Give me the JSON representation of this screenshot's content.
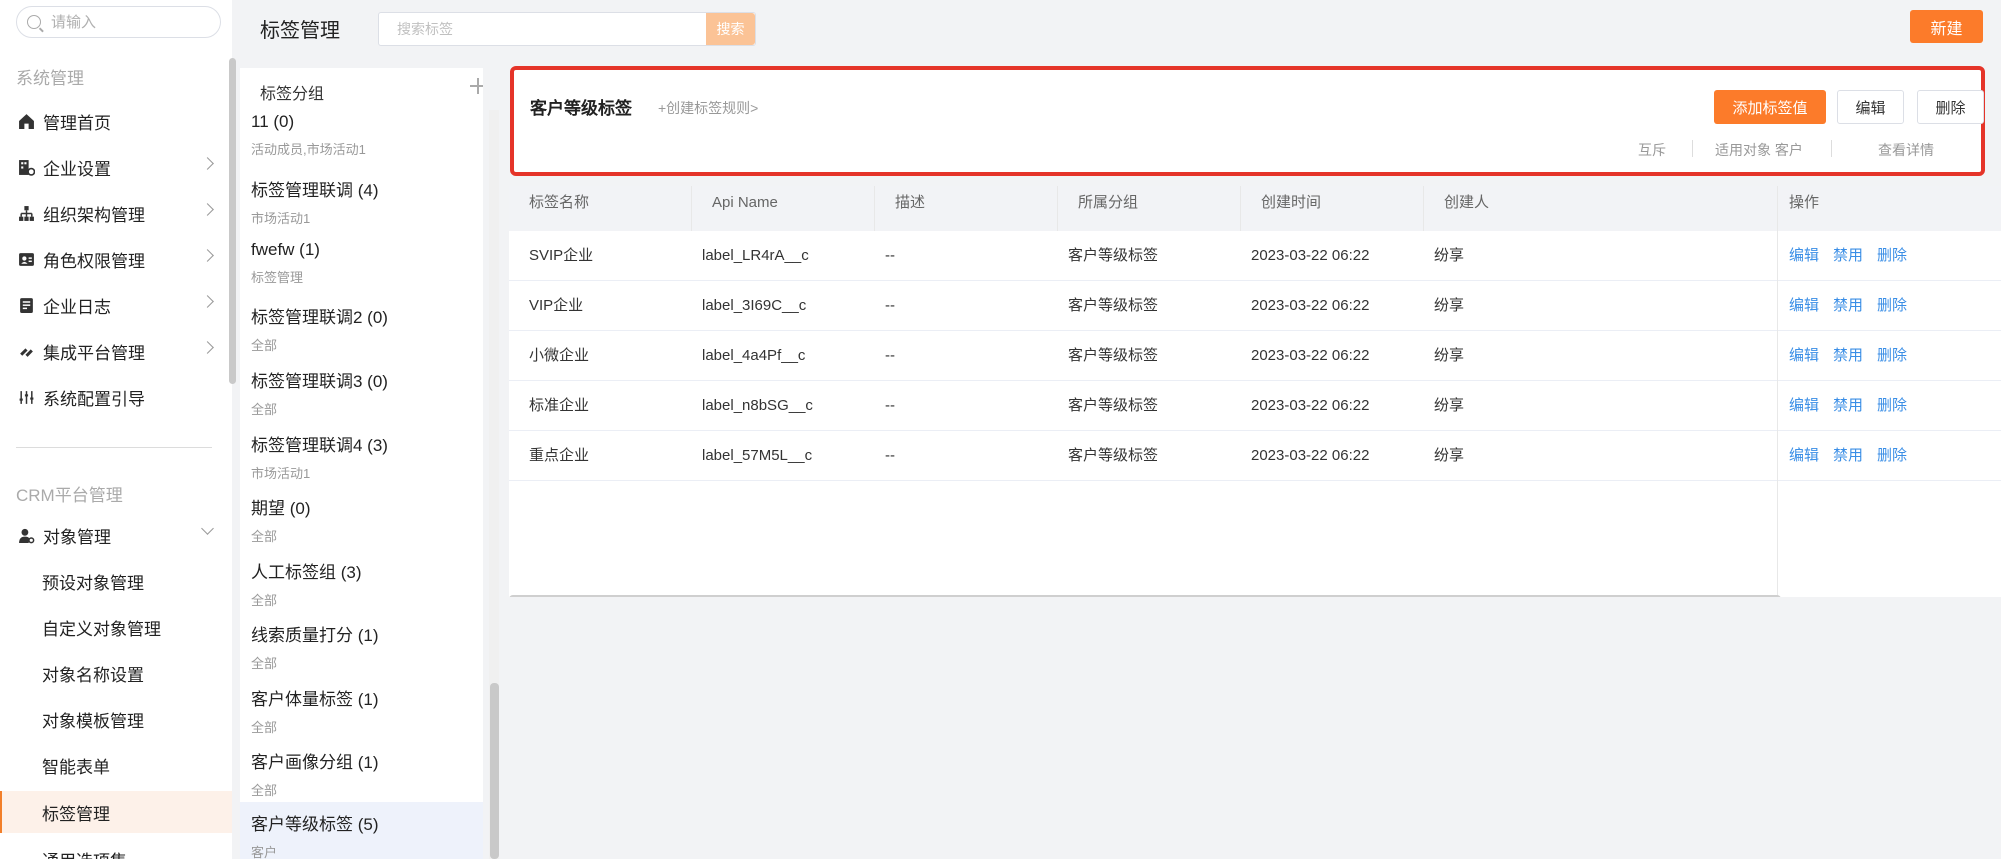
{
  "sidebar": {
    "search_placeholder": "请输入",
    "section_system": "系统管理",
    "items": [
      {
        "label": "管理首页",
        "icon": "home-icon"
      },
      {
        "label": "企业设置",
        "icon": "company-settings-icon"
      },
      {
        "label": "组织架构管理",
        "icon": "org-chart-icon"
      },
      {
        "label": "角色权限管理",
        "icon": "id-card-icon"
      },
      {
        "label": "企业日志",
        "icon": "log-icon"
      },
      {
        "label": "集成平台管理",
        "icon": "integration-icon"
      },
      {
        "label": "系统配置引导",
        "icon": "sliders-icon"
      }
    ],
    "section_crm": "CRM平台管理",
    "object_mgmt": {
      "label": "对象管理",
      "icon": "user-gear-icon"
    },
    "sub_items": [
      "预设对象管理",
      "自定义对象管理",
      "对象名称设置",
      "对象模板管理",
      "智能表单",
      "标签管理",
      "通用选项集"
    ]
  },
  "header": {
    "title": "标签管理",
    "search_placeholder": "搜索标签",
    "search_button": "搜索",
    "new_button": "新建"
  },
  "groups": {
    "header": "标签分组",
    "items": [
      {
        "name": "11 (0)",
        "sub": "活动成员,市场活动1"
      },
      {
        "name": "标签管理联调 (4)",
        "sub": "市场活动1"
      },
      {
        "name": "fwefw (1)",
        "sub": "标签管理"
      },
      {
        "name": "标签管理联调2 (0)",
        "sub": "全部"
      },
      {
        "name": "标签管理联调3 (0)",
        "sub": "全部"
      },
      {
        "name": "标签管理联调4 (3)",
        "sub": "市场活动1"
      },
      {
        "name": "期望 (0)",
        "sub": "全部"
      },
      {
        "name": "人工标签组 (3)",
        "sub": "全部"
      },
      {
        "name": "线索质量打分 (1)",
        "sub": "全部"
      },
      {
        "name": "客户体量标签 (1)",
        "sub": "全部"
      },
      {
        "name": "客户画像分组 (1)",
        "sub": "全部"
      },
      {
        "name": "客户等级标签 (5)",
        "sub": "客户"
      }
    ]
  },
  "detail": {
    "title": "客户等级标签",
    "rule_link": "+创建标签规则>",
    "add_value_button": "添加标签值",
    "edit_button": "编辑",
    "delete_button": "删除",
    "mutex": "互斥",
    "applies_to": "适用对象 客户",
    "view_detail": "查看详情"
  },
  "table": {
    "columns": [
      "标签名称",
      "Api Name",
      "描述",
      "所属分组",
      "创建时间",
      "创建人",
      "操作"
    ],
    "rows": [
      [
        "SVIP企业",
        "label_LR4rA__c",
        "--",
        "客户等级标签",
        "2023-03-22 06:22",
        "纷享"
      ],
      [
        "VIP企业",
        "label_3I69C__c",
        "--",
        "客户等级标签",
        "2023-03-22 06:22",
        "纷享"
      ],
      [
        "小微企业",
        "label_4a4Pf__c",
        "--",
        "客户等级标签",
        "2023-03-22 06:22",
        "纷享"
      ],
      [
        "标准企业",
        "label_n8bSG__c",
        "--",
        "客户等级标签",
        "2023-03-22 06:22",
        "纷享"
      ],
      [
        "重点企业",
        "label_57M5L__c",
        "--",
        "客户等级标签",
        "2023-03-22 06:22",
        "纷享"
      ]
    ],
    "ops": [
      "编辑",
      "禁用",
      "删除"
    ]
  },
  "colors": {
    "accent": "#fc7b2a",
    "link": "#3a8ee6",
    "highlight_border": "#e53429"
  }
}
